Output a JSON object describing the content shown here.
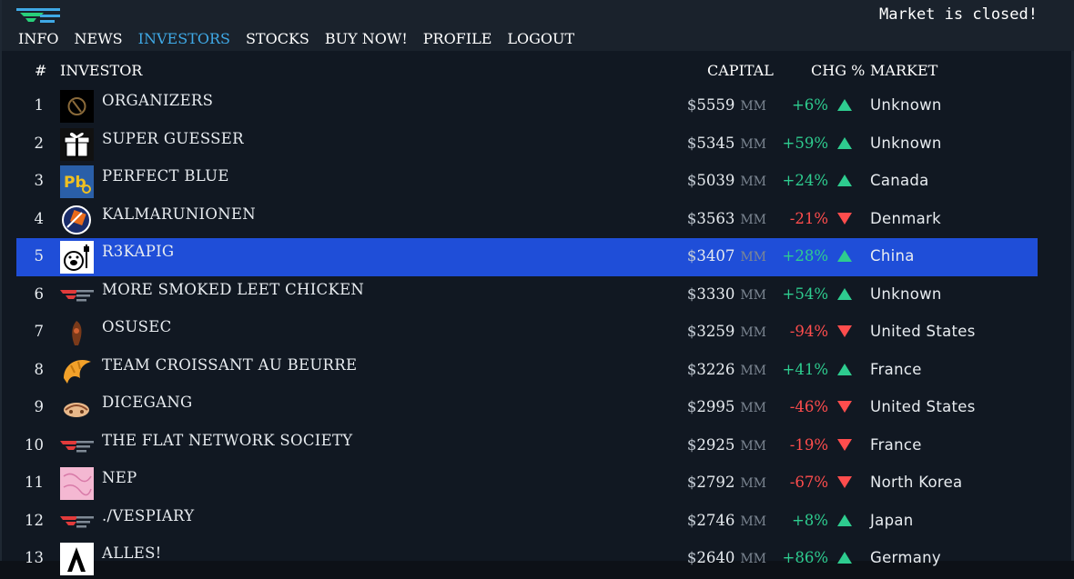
{
  "nav": {
    "items": [
      {
        "label": "INFO",
        "active": false
      },
      {
        "label": "NEWS",
        "active": false
      },
      {
        "label": "INVESTORS",
        "active": true
      },
      {
        "label": "STOCKS",
        "active": false
      },
      {
        "label": "BUY NOW!",
        "active": false
      },
      {
        "label": "PROFILE",
        "active": false
      },
      {
        "label": "LOGOUT",
        "active": false
      }
    ]
  },
  "status": {
    "market": "Market is closed!"
  },
  "table": {
    "headers": {
      "num": "#",
      "investor": "INVESTOR",
      "capital": "CAPITAL",
      "chg": "CHG %",
      "market": "MARKET"
    },
    "unit": "MM",
    "rows": [
      {
        "num": "1",
        "name": "ORGANIZERS",
        "capital": "5559",
        "chg": "+6%",
        "dir": "up",
        "market": "Unknown",
        "avatar": "organizers-logo-icon"
      },
      {
        "num": "2",
        "name": "SUPER GUESSER",
        "capital": "5345",
        "chg": "+59%",
        "dir": "up",
        "market": "Unknown",
        "avatar": "gift-box-icon"
      },
      {
        "num": "3",
        "name": "PERFECT BLUE",
        "capital": "5039",
        "chg": "+24%",
        "dir": "up",
        "market": "Canada",
        "avatar": "pb-logo-icon"
      },
      {
        "num": "4",
        "name": "KALMARUNIONEN",
        "capital": "3563",
        "chg": "-21%",
        "dir": "down",
        "market": "Denmark",
        "avatar": "kalmar-shield-icon"
      },
      {
        "num": "5",
        "name": "R3KAPIG",
        "capital": "3407",
        "chg": "+28%",
        "dir": "up",
        "market": "China",
        "avatar": "pig-icon",
        "highlight": true
      },
      {
        "num": "6",
        "name": "MORE SMOKED LEET CHICKEN",
        "capital": "3330",
        "chg": "+54%",
        "dir": "up",
        "market": "Unknown",
        "avatar": "default-flag-icon"
      },
      {
        "num": "7",
        "name": "OSUSEC",
        "capital": "3259",
        "chg": "-94%",
        "dir": "down",
        "market": "United States",
        "avatar": "osusec-logo-icon"
      },
      {
        "num": "8",
        "name": "TEAM CROISSANT AU BEURRE",
        "capital": "3226",
        "chg": "+41%",
        "dir": "up",
        "market": "France",
        "avatar": "croissant-icon"
      },
      {
        "num": "9",
        "name": "DICEGANG",
        "capital": "2995",
        "chg": "-46%",
        "dir": "down",
        "market": "United States",
        "avatar": "dicegang-logo-icon"
      },
      {
        "num": "10",
        "name": "THE FLAT NETWORK SOCIETY",
        "capital": "2925",
        "chg": "-19%",
        "dir": "down",
        "market": "France",
        "avatar": "default-flag-icon"
      },
      {
        "num": "11",
        "name": "NEP",
        "capital": "2792",
        "chg": "-67%",
        "dir": "down",
        "market": "North Korea",
        "avatar": "pink-pattern-icon"
      },
      {
        "num": "12",
        "name": "./VESPIARY",
        "capital": "2746",
        "chg": "+8%",
        "dir": "up",
        "market": "Japan",
        "avatar": "default-flag-icon"
      },
      {
        "num": "13",
        "name": "ALLES!",
        "capital": "2640",
        "chg": "+86%",
        "dir": "up",
        "market": "Germany",
        "avatar": "alles-logo-icon"
      }
    ]
  }
}
